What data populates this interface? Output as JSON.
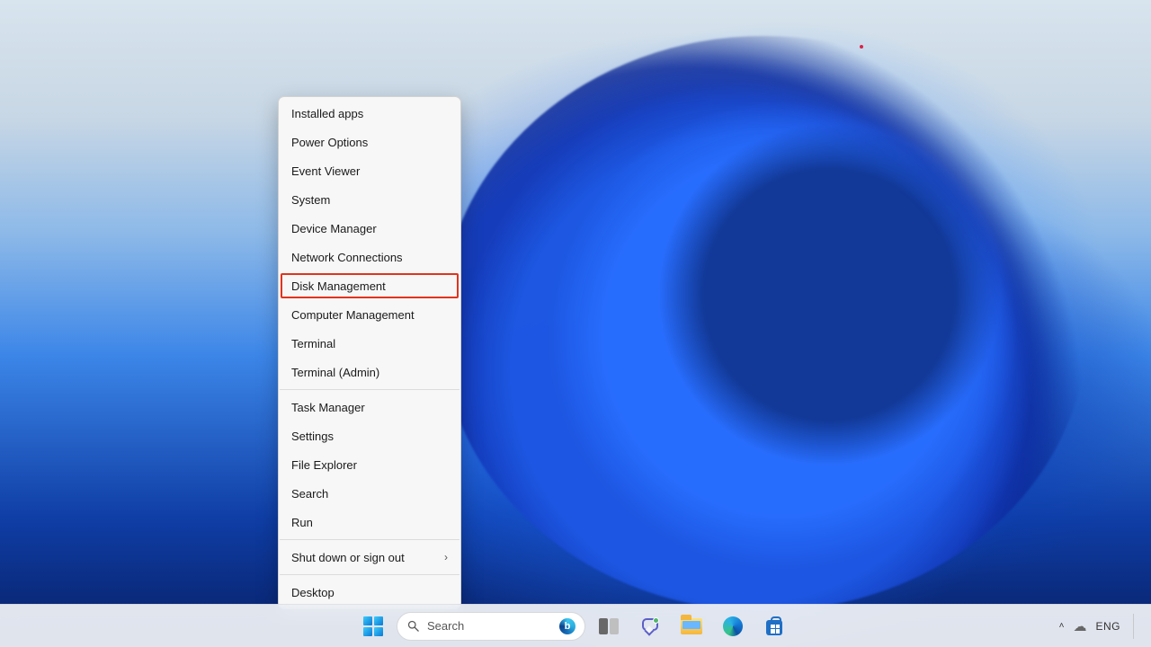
{
  "context_menu": {
    "groups": [
      [
        {
          "id": "installed-apps",
          "label": "Installed apps",
          "submenu": false,
          "highlight": false
        },
        {
          "id": "power-options",
          "label": "Power Options",
          "submenu": false,
          "highlight": false
        },
        {
          "id": "event-viewer",
          "label": "Event Viewer",
          "submenu": false,
          "highlight": false
        },
        {
          "id": "system",
          "label": "System",
          "submenu": false,
          "highlight": false
        },
        {
          "id": "device-manager",
          "label": "Device Manager",
          "submenu": false,
          "highlight": false
        },
        {
          "id": "network-connections",
          "label": "Network Connections",
          "submenu": false,
          "highlight": false
        },
        {
          "id": "disk-management",
          "label": "Disk Management",
          "submenu": false,
          "highlight": true
        },
        {
          "id": "computer-management",
          "label": "Computer Management",
          "submenu": false,
          "highlight": false
        },
        {
          "id": "terminal",
          "label": "Terminal",
          "submenu": false,
          "highlight": false
        },
        {
          "id": "terminal-admin",
          "label": "Terminal (Admin)",
          "submenu": false,
          "highlight": false
        }
      ],
      [
        {
          "id": "task-manager",
          "label": "Task Manager",
          "submenu": false,
          "highlight": false
        },
        {
          "id": "settings",
          "label": "Settings",
          "submenu": false,
          "highlight": false
        },
        {
          "id": "file-explorer",
          "label": "File Explorer",
          "submenu": false,
          "highlight": false
        },
        {
          "id": "search",
          "label": "Search",
          "submenu": false,
          "highlight": false
        },
        {
          "id": "run",
          "label": "Run",
          "submenu": false,
          "highlight": false
        }
      ],
      [
        {
          "id": "shut-down",
          "label": "Shut down or sign out",
          "submenu": true,
          "highlight": false
        }
      ],
      [
        {
          "id": "desktop",
          "label": "Desktop",
          "submenu": false,
          "highlight": false
        }
      ]
    ]
  },
  "taskbar": {
    "search_placeholder": "Search",
    "pins": [
      {
        "id": "start",
        "name": "start-button",
        "icon": "windows-logo-icon"
      },
      {
        "id": "search",
        "name": "search-box",
        "icon": "search-icon"
      },
      {
        "id": "taskview",
        "name": "task-view-button",
        "icon": "task-view-icon"
      },
      {
        "id": "chat",
        "name": "chat-button",
        "icon": "chat-icon"
      },
      {
        "id": "explorer",
        "name": "file-explorer-button",
        "icon": "folder-icon"
      },
      {
        "id": "edge",
        "name": "edge-button",
        "icon": "edge-icon"
      },
      {
        "id": "store",
        "name": "store-button",
        "icon": "store-icon"
      }
    ],
    "tray": {
      "overflow_chevron": "˄",
      "weather_icon": "cloud-icon",
      "language": "ENG"
    }
  }
}
